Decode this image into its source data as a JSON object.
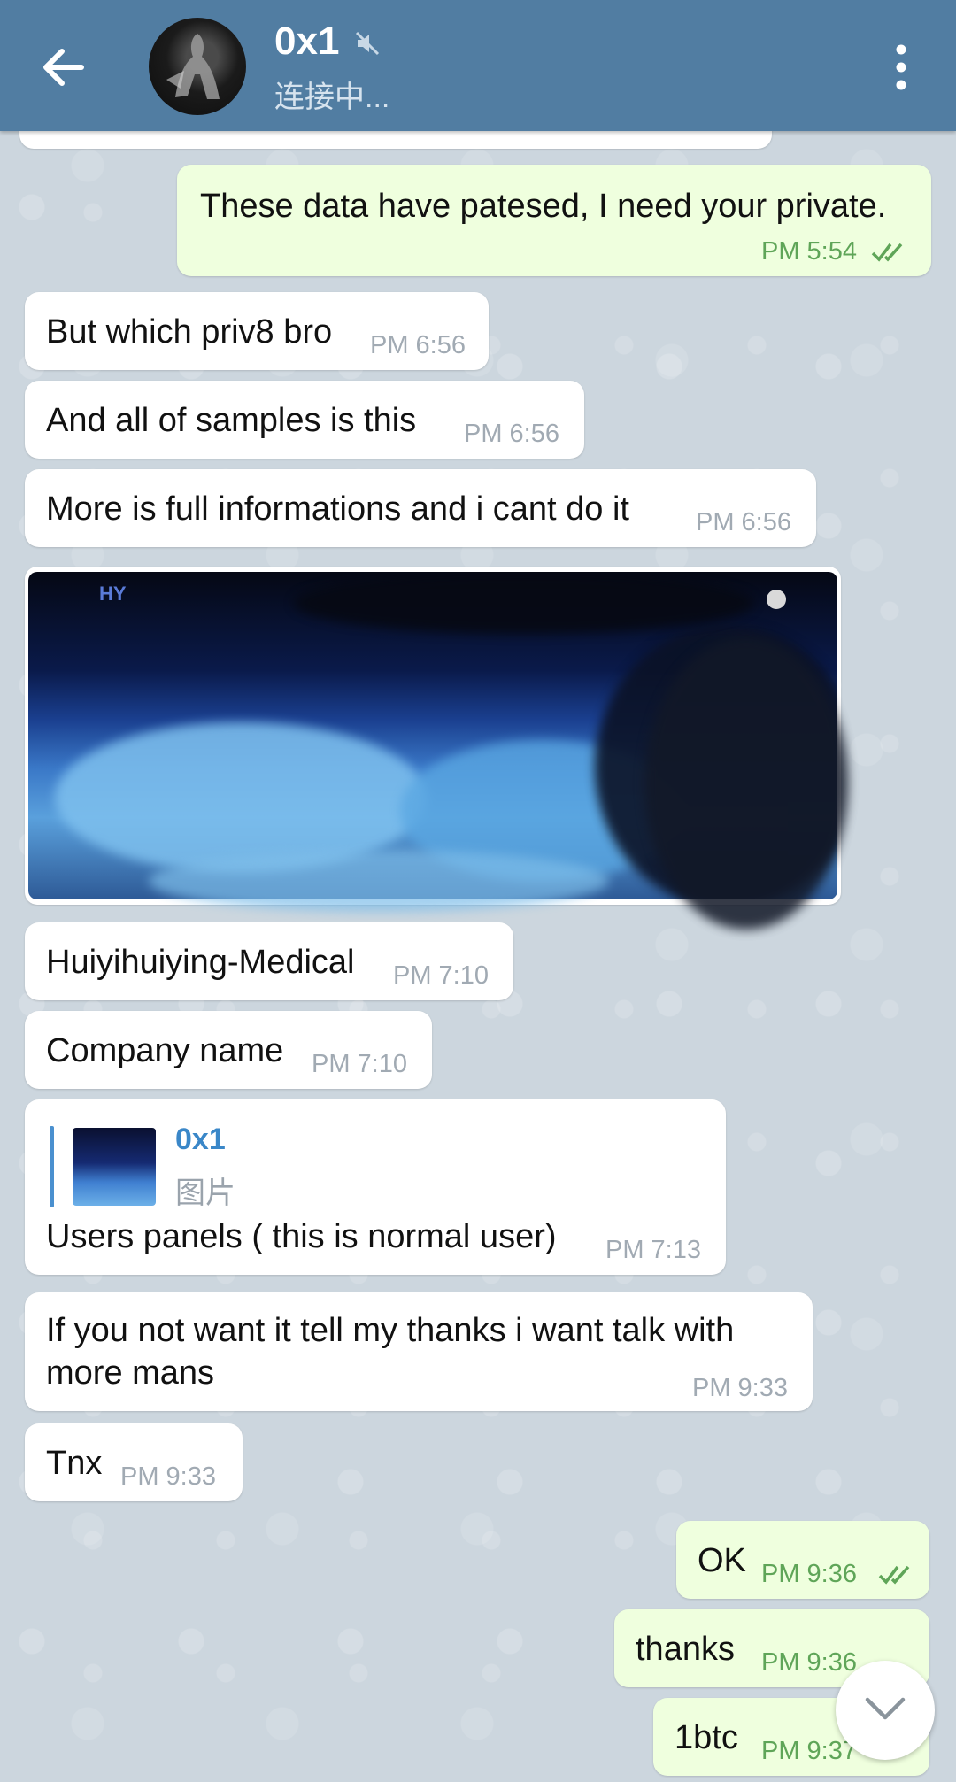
{
  "header": {
    "title": "0x1",
    "status": "连接中..."
  },
  "messages": [
    {
      "text": "These data have patesed, I need your private.",
      "time": "PM 5:54"
    },
    {
      "text": "But which priv8 bro",
      "time": "PM 6:56"
    },
    {
      "text": "And all of samples is this",
      "time": "PM 6:56"
    },
    {
      "text": "More is full informations and i cant do it",
      "time": "PM 6:56"
    },
    {
      "text": "Huiyihuiying-Medical",
      "time": "PM 7:10"
    },
    {
      "text": "Company name",
      "time": "PM 7:10"
    },
    {
      "text": "Users panels ( this is normal user)",
      "time": "PM 7:13"
    },
    {
      "line1": "If you not want it tell my thanks i want talk with",
      "line2": "more mans",
      "time": "PM 9:33"
    },
    {
      "text": "Tnx",
      "time": "PM 9:33"
    },
    {
      "text": "OK",
      "time": "PM 9:36"
    },
    {
      "text": "thanks",
      "time": "PM 9:36"
    },
    {
      "text": "1btc",
      "time": "PM 9:37"
    }
  ],
  "photo": {
    "logo": "HY"
  },
  "reply": {
    "name": "0x1",
    "text": "图片"
  },
  "colors": {
    "header": "#517da2",
    "outgoing_bubble": "#efffde",
    "incoming_bubble": "#ffffff",
    "read_check": "#5fa558",
    "reply_accent": "#4a90cf"
  },
  "icons": [
    "back-arrow-icon",
    "mute-icon",
    "more-vert-icon",
    "double-check-icon",
    "chevron-down-icon"
  ]
}
